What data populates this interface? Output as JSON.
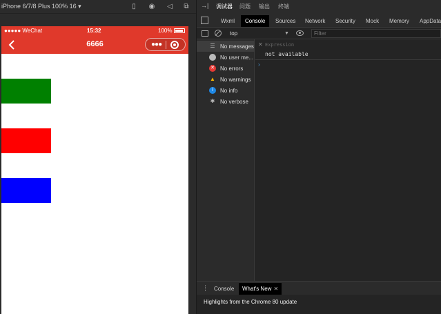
{
  "simulator": {
    "device_label": "iPhone 6/7/8 Plus 100% 16 ▾",
    "status_bar": {
      "carrier": "●●●●● WeChat",
      "time": "15:32",
      "battery": "100%"
    },
    "nav_bar": {
      "title": "6666"
    },
    "blocks": [
      {
        "name": "green",
        "color": "#008000"
      },
      {
        "name": "red",
        "color": "#ff0000"
      },
      {
        "name": "blue",
        "color": "#0000ff"
      }
    ],
    "nav_color": "#e0392b"
  },
  "devtools": {
    "top_tabs": [
      "调试器",
      "问题",
      "输出",
      "终端"
    ],
    "panel_tabs": [
      "Wxml",
      "Console",
      "Sources",
      "Network",
      "Security",
      "Mock",
      "Memory",
      "AppData"
    ],
    "active_panel": "Console",
    "console_toolbar": {
      "context": "top",
      "filter_placeholder": "Filter"
    },
    "sidebar": [
      {
        "label": "No messages",
        "icon": "list-icon"
      },
      {
        "label": "No user me...",
        "icon": "user-icon"
      },
      {
        "label": "No errors",
        "icon": "error-icon"
      },
      {
        "label": "No warnings",
        "icon": "warning-icon"
      },
      {
        "label": "No info",
        "icon": "info-icon"
      },
      {
        "label": "No verbose",
        "icon": "bug-icon"
      }
    ],
    "expression": {
      "placeholder": "Expression",
      "result": "not available"
    },
    "drawer": {
      "tabs": [
        "Console",
        "What's New"
      ],
      "active": "What's New",
      "content": "Highlights from the Chrome 80 update"
    }
  }
}
